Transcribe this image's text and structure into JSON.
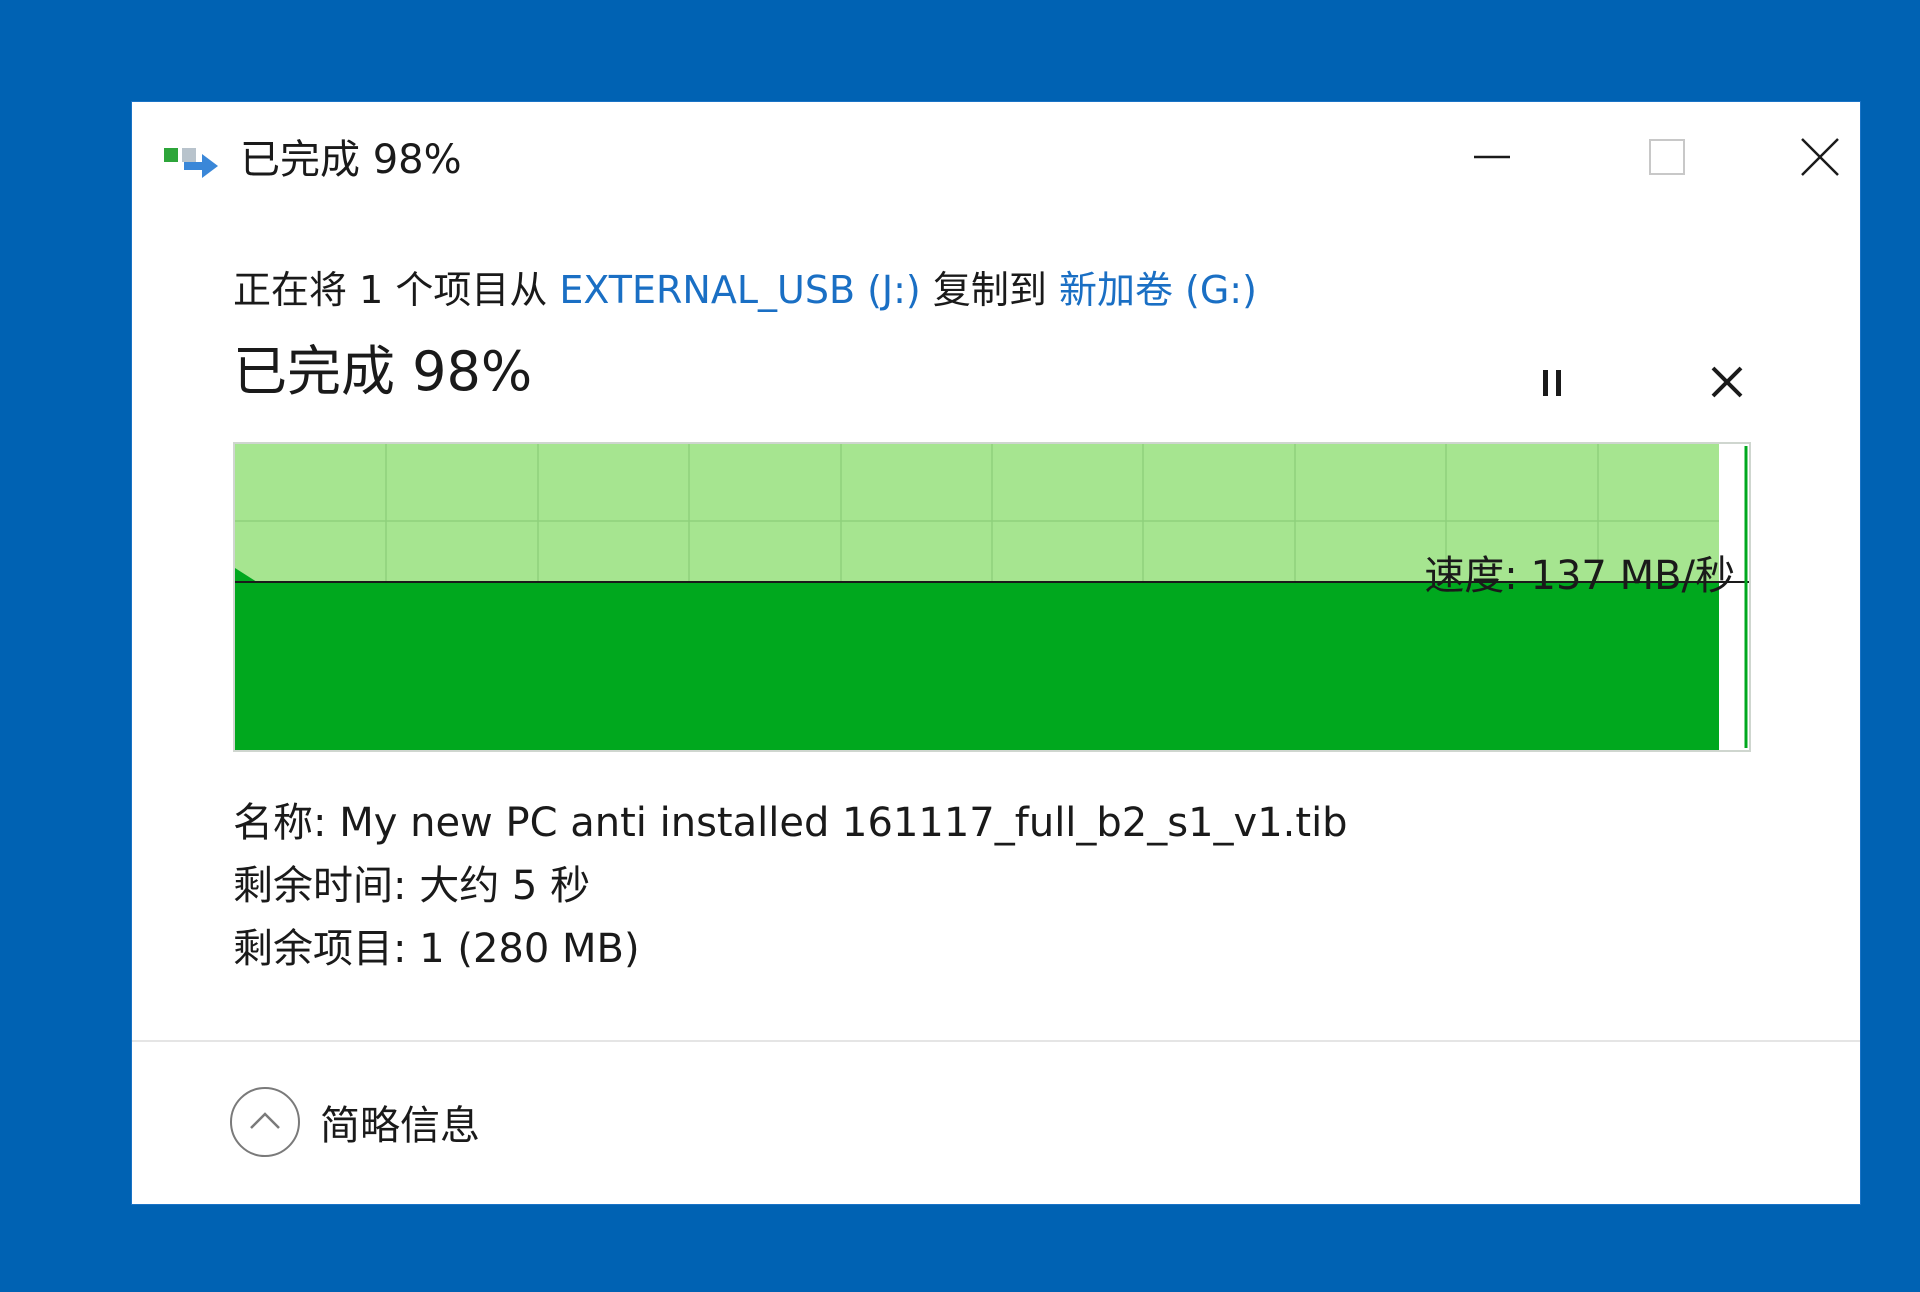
{
  "window": {
    "title": "已完成 98%",
    "controls": {
      "minimize": "minimize-icon",
      "maximize": "maximize-icon",
      "close": "close-icon"
    }
  },
  "copy": {
    "prefix": "正在将 1 个项目从 ",
    "source": "EXTERNAL_USB (J:)",
    "middle": " 复制到 ",
    "destination": "新加卷 (G:)"
  },
  "progress": {
    "heading": "已完成 98%",
    "percent": 98
  },
  "graph": {
    "speed_label": "速度: 137 MB/秒",
    "speed_level_fraction": 0.45
  },
  "details": {
    "name": "名称: My new PC anti installed 161117_full_b2_s1_v1.tib",
    "time_remaining": "剩余时间: 大约 5 秒",
    "items_remaining": "剩余项目: 1 (280 MB)"
  },
  "footer": {
    "label": "简略信息"
  },
  "colors": {
    "background": "#0062b3",
    "link": "#1a6fc4",
    "graph_fill": "#00a81e",
    "graph_progress_bg": "#a6e590",
    "graph_grid": "#8fd17c"
  }
}
